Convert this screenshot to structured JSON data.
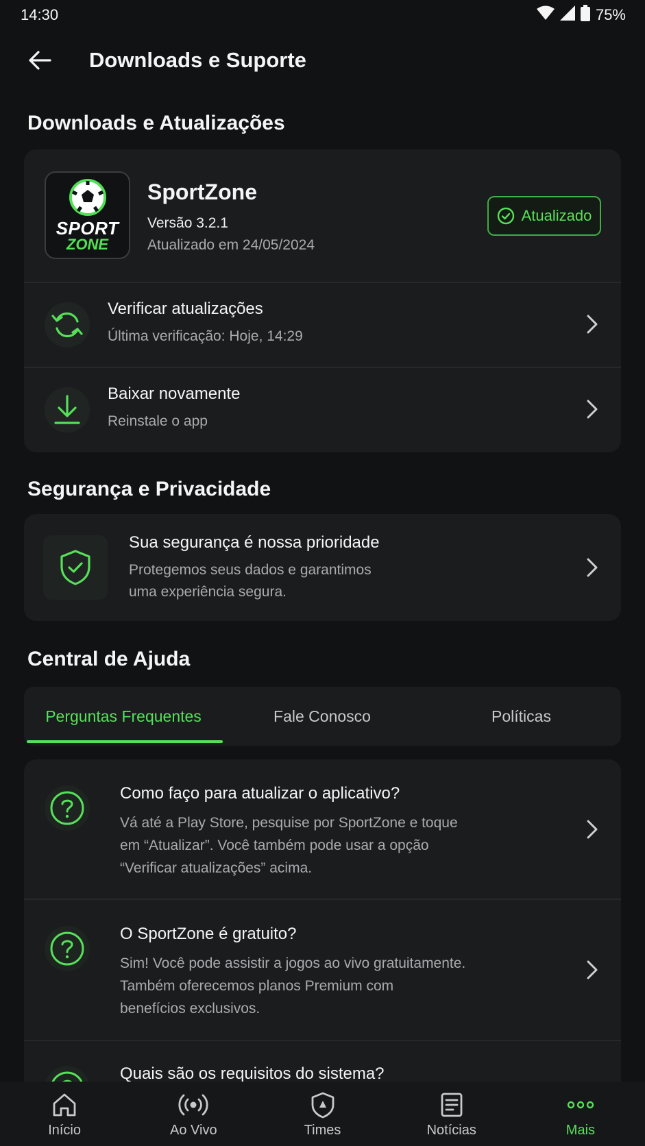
{
  "status_bar": {
    "time": "14:30",
    "battery": "75%"
  },
  "app_bar": {
    "title": "Downloads e Suporte"
  },
  "downloads": {
    "section_title": "Downloads e Atualizações",
    "app": {
      "logo_top": "SPORT",
      "logo_bottom": "ZONE",
      "name": "SportZone",
      "version": "Versão 3.2.1",
      "updated": "Atualizado em 24/05/2024",
      "badge": "Atualizado"
    },
    "check_updates": {
      "title": "Verificar atualizações",
      "subtitle": "Última verificação: Hoje, 14:29"
    },
    "redownload": {
      "title": "Baixar novamente",
      "subtitle": "Reinstale o app"
    }
  },
  "security": {
    "section_title": "Segurança e Privacidade",
    "title": "Sua segurança é nossa prioridade",
    "subtitle_line1": "Protegemos seus dados e garantimos",
    "subtitle_line2": "uma experiência segura."
  },
  "help": {
    "section_title": "Central de Ajuda",
    "tabs": [
      "Perguntas Frequentes",
      "Fale Conosco",
      "Políticas"
    ],
    "faqs": [
      {
        "question": "Como faço para atualizar o aplicativo?",
        "answer_lines": [
          "Vá até a Play Store, pesquise por SportZone e toque",
          "em “Atualizar”. Você também pode usar a opção",
          "“Verificar atualizações” acima."
        ]
      },
      {
        "question": "O SportZone é gratuito?",
        "answer_lines": [
          "Sim! Você pode assistir a jogos ao vivo gratuitamente.",
          "Também oferecemos planos Premium com",
          "benefícios exclusivos."
        ]
      },
      {
        "question": "Quais são os requisitos do sistema?",
        "answer_lines": []
      }
    ]
  },
  "bottom_nav": {
    "items": [
      {
        "label": "Início",
        "icon": "home-icon"
      },
      {
        "label": "Ao Vivo",
        "icon": "live-icon"
      },
      {
        "label": "Times",
        "icon": "shield-icon"
      },
      {
        "label": "Notícias",
        "icon": "news-icon"
      },
      {
        "label": "Mais",
        "icon": "more-icon"
      }
    ],
    "active_index": 4
  },
  "colors": {
    "accent": "#56e05a",
    "background": "#111214",
    "card": "#1b1c1e"
  }
}
